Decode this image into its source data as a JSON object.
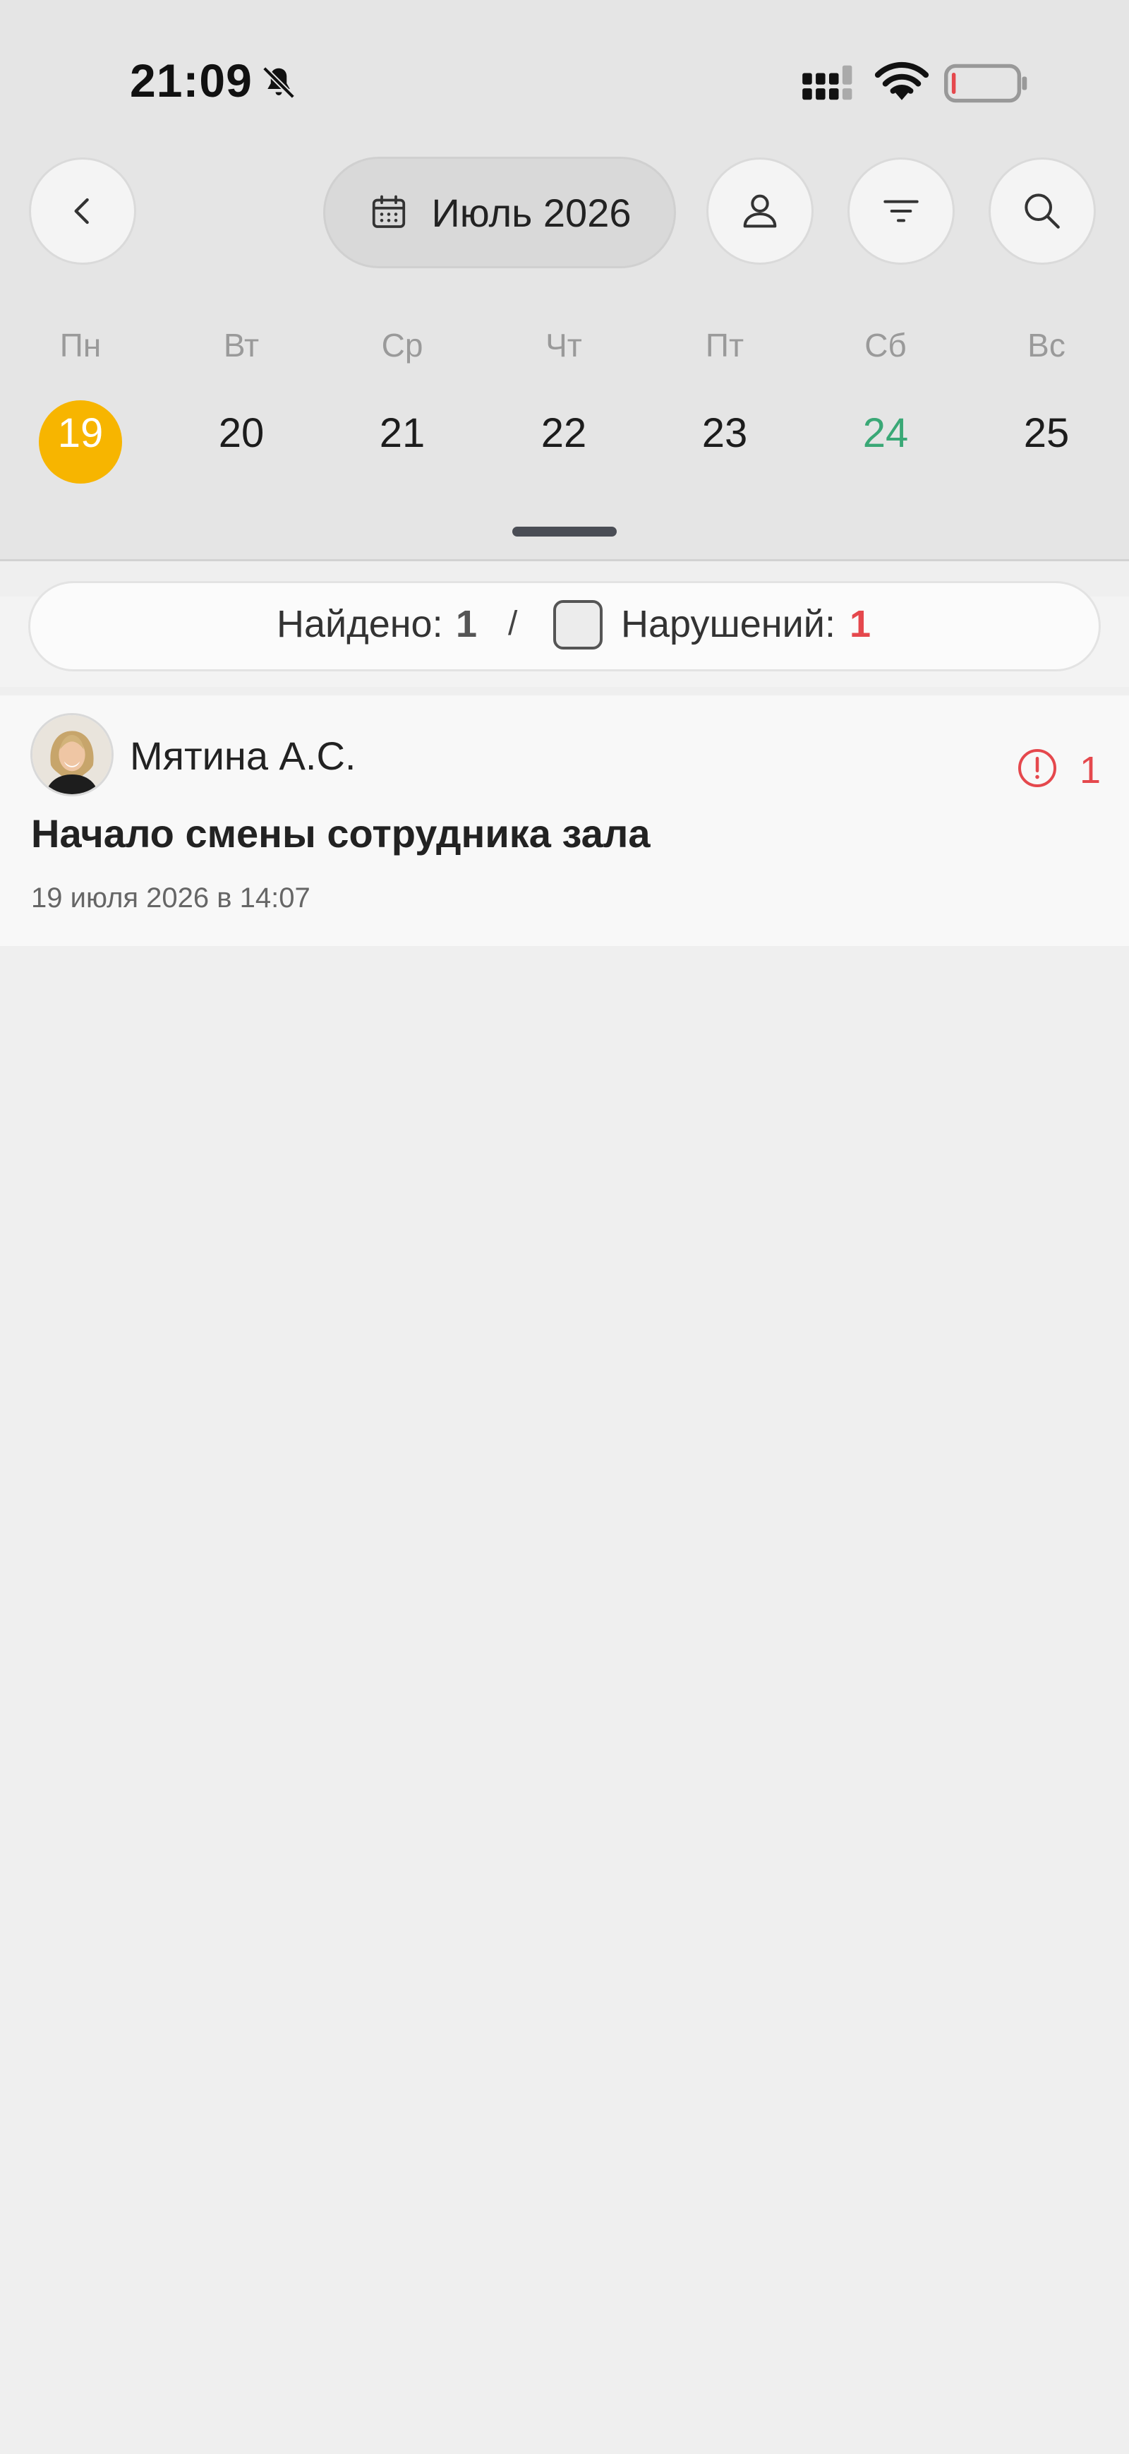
{
  "status_bar": {
    "time": "21:09"
  },
  "toolbar": {
    "month_label": "Июль 2026"
  },
  "week": {
    "weekdays": [
      "Пн",
      "Вт",
      "Ср",
      "Чт",
      "Пт",
      "Сб",
      "Вс"
    ],
    "days": [
      "19",
      "20",
      "21",
      "22",
      "23",
      "24",
      "25"
    ],
    "selected_day": "19"
  },
  "summary": {
    "found_label": "Найдено:",
    "found_count": "1",
    "separator": "/",
    "violations_label": "Нарушений:",
    "violations_count": "1"
  },
  "event": {
    "user_name": "Мятина А.С.",
    "alert_count": "1",
    "title": "Начало смены сотрудника зала",
    "datetime": "19 июля 2026 в 14:07"
  },
  "colors": {
    "accent": "#f7b500",
    "alert": "#e5484d",
    "weekend": "#3aa876"
  },
  "icons": [
    "bell-off-icon",
    "signal-icon",
    "wifi-icon",
    "battery-low-icon",
    "back-icon",
    "calendar-icon",
    "person-icon",
    "filter-icon",
    "search-icon",
    "alert-circle-icon"
  ]
}
